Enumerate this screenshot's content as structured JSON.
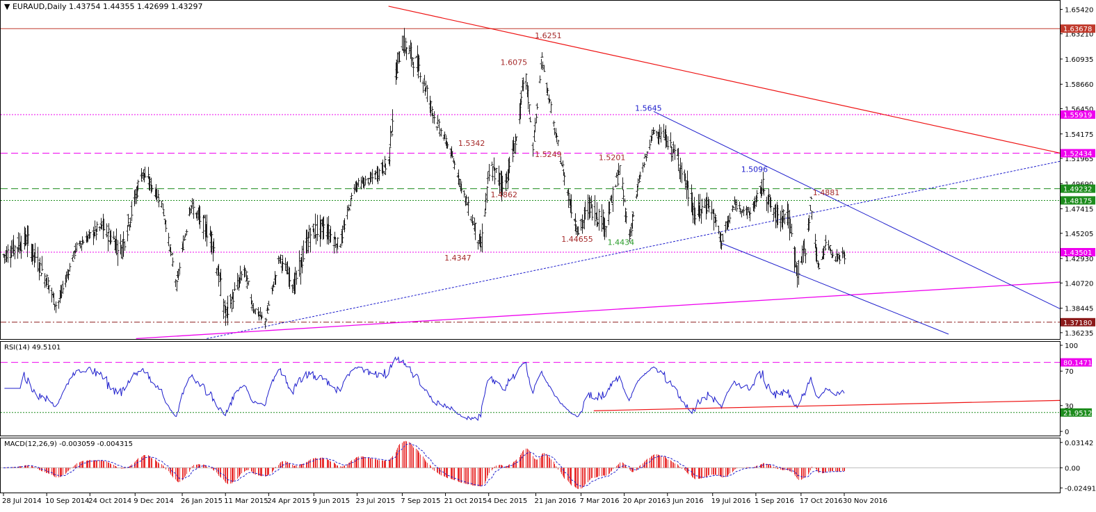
{
  "chart_data": [
    {
      "panel": "main",
      "type": "ohlc",
      "title": "EURAUD,Daily",
      "ohlc_header": "1.43754 1.44355 1.42699 1.43297",
      "y_ticks": [
        "1.65420",
        "1.63210",
        "1.60935",
        "1.58660",
        "1.56450",
        "1.54175",
        "1.51965",
        "1.49690",
        "1.47415",
        "1.45205",
        "1.42930",
        "1.40720",
        "1.38445",
        "1.36235"
      ],
      "ylim": [
        1.356,
        1.662
      ],
      "horizontal_levels": [
        {
          "label": "1.63678",
          "value": 1.63678,
          "color": "#c0392b",
          "style": "solid"
        },
        {
          "label": "1.55919",
          "value": 1.55919,
          "color": "#ee00ee",
          "style": "dotted"
        },
        {
          "label": "1.52434",
          "value": 1.52434,
          "color": "#ee00ee",
          "style": "dashed"
        },
        {
          "label": "1.49232",
          "value": 1.49232,
          "color": "#1d8c1d",
          "style": "dashed"
        },
        {
          "label": "1.48175",
          "value": 1.48175,
          "color": "#1d8c1d",
          "style": "dotted"
        },
        {
          "label": "1.43501",
          "value": 1.43501,
          "color": "#ee00ee",
          "style": "dotted"
        },
        {
          "label": "1.37180",
          "value": 1.3718,
          "color": "#8b1a1a",
          "style": "dashdot"
        }
      ],
      "annotations": [
        {
          "text": "1.6251",
          "color": "#a52a2a"
        },
        {
          "text": "1.6075",
          "color": "#a52a2a"
        },
        {
          "text": "1.5342",
          "color": "#a52a2a"
        },
        {
          "text": "1.5249",
          "color": "#a52a2a"
        },
        {
          "text": "1.5201",
          "color": "#a52a2a"
        },
        {
          "text": "1.4862",
          "color": "#a52a2a"
        },
        {
          "text": "1.44655",
          "color": "#a52a2a"
        },
        {
          "text": "1.4347",
          "color": "#a52a2a"
        },
        {
          "text": "1.4881",
          "color": "#a52a2a"
        },
        {
          "text": "1.5645",
          "color": "#1c1ccc"
        },
        {
          "text": "1.5096",
          "color": "#1c1ccc"
        },
        {
          "text": "1.4434",
          "color": "#2a9d2a"
        }
      ],
      "trendlines": [
        {
          "name": "resistance",
          "color": "#ee1111"
        },
        {
          "name": "rising-dotted-support",
          "color": "#1c1ccc"
        },
        {
          "name": "magenta-support",
          "color": "#ee00ee"
        },
        {
          "name": "channel-upper",
          "color": "#1c1ccc"
        },
        {
          "name": "channel-lower",
          "color": "#1c1ccc"
        }
      ],
      "anchors": [
        {
          "date": "2014-07-28",
          "close": 1.432
        },
        {
          "date": "2014-08-20",
          "close": 1.447
        },
        {
          "date": "2014-09-10",
          "close": 1.41
        },
        {
          "date": "2014-09-20",
          "close": 1.385
        },
        {
          "date": "2014-10-10",
          "close": 1.44
        },
        {
          "date": "2014-11-05",
          "close": 1.458
        },
        {
          "date": "2014-11-25",
          "close": 1.438
        },
        {
          "date": "2014-12-16",
          "close": 1.508
        },
        {
          "date": "2015-01-05",
          "close": 1.48
        },
        {
          "date": "2015-01-20",
          "close": 1.405
        },
        {
          "date": "2015-02-03",
          "close": 1.478
        },
        {
          "date": "2015-02-25",
          "close": 1.448
        },
        {
          "date": "2015-03-11",
          "close": 1.378
        },
        {
          "date": "2015-03-30",
          "close": 1.42
        },
        {
          "date": "2015-04-08",
          "close": 1.385
        },
        {
          "date": "2015-04-20",
          "close": 1.372
        },
        {
          "date": "2015-05-05",
          "close": 1.43
        },
        {
          "date": "2015-05-20",
          "close": 1.405
        },
        {
          "date": "2015-06-05",
          "close": 1.452
        },
        {
          "date": "2015-06-20",
          "close": 1.458
        },
        {
          "date": "2015-07-05",
          "close": 1.44
        },
        {
          "date": "2015-07-20",
          "close": 1.495
        },
        {
          "date": "2015-08-05",
          "close": 1.5
        },
        {
          "date": "2015-08-24",
          "close": 1.516
        },
        {
          "date": "2015-09-01",
          "close": 1.6
        },
        {
          "date": "2015-09-07",
          "close": 1.625
        },
        {
          "date": "2015-09-25",
          "close": 1.6
        },
        {
          "date": "2015-10-10",
          "close": 1.555
        },
        {
          "date": "2015-10-25",
          "close": 1.528
        },
        {
          "date": "2015-11-15",
          "close": 1.47
        },
        {
          "date": "2015-11-26",
          "close": 1.44
        },
        {
          "date": "2015-12-05",
          "close": 1.512
        },
        {
          "date": "2015-12-20",
          "close": 1.495
        },
        {
          "date": "2016-01-01",
          "close": 1.538
        },
        {
          "date": "2016-01-10",
          "close": 1.6
        },
        {
          "date": "2016-01-18",
          "close": 1.53
        },
        {
          "date": "2016-01-27",
          "close": 1.61
        },
        {
          "date": "2016-02-10",
          "close": 1.54
        },
        {
          "date": "2016-02-25",
          "close": 1.478
        },
        {
          "date": "2016-03-05",
          "close": 1.452
        },
        {
          "date": "2016-03-15",
          "close": 1.478
        },
        {
          "date": "2016-04-01",
          "close": 1.46
        },
        {
          "date": "2016-04-15",
          "close": 1.51
        },
        {
          "date": "2016-04-25",
          "close": 1.448
        },
        {
          "date": "2016-05-05",
          "close": 1.5
        },
        {
          "date": "2016-05-20",
          "close": 1.545
        },
        {
          "date": "2016-06-01",
          "close": 1.538
        },
        {
          "date": "2016-06-15",
          "close": 1.516
        },
        {
          "date": "2016-07-01",
          "close": 1.468
        },
        {
          "date": "2016-07-15",
          "close": 1.48
        },
        {
          "date": "2016-07-28",
          "close": 1.445
        },
        {
          "date": "2016-08-10",
          "close": 1.478
        },
        {
          "date": "2016-08-26",
          "close": 1.47
        },
        {
          "date": "2016-09-08",
          "close": 1.495
        },
        {
          "date": "2016-09-20",
          "close": 1.468
        },
        {
          "date": "2016-10-03",
          "close": 1.47
        },
        {
          "date": "2016-10-13",
          "close": 1.418
        },
        {
          "date": "2016-10-21",
          "close": 1.438
        },
        {
          "date": "2016-10-27",
          "close": 1.48
        },
        {
          "date": "2016-11-03",
          "close": 1.42
        },
        {
          "date": "2016-11-12",
          "close": 1.445
        },
        {
          "date": "2016-11-20",
          "close": 1.43
        },
        {
          "date": "2016-11-30",
          "close": 1.433
        }
      ]
    },
    {
      "panel": "rsi",
      "type": "line",
      "title": "RSI(14) 49.5101",
      "y_ticks": [
        "100",
        "70",
        "30",
        "0"
      ],
      "ylim": [
        0,
        100
      ],
      "levels": [
        {
          "label": "80.1471",
          "value": 80.1471,
          "color": "#ee00ee",
          "style": "dashed"
        },
        {
          "label": "21.9512",
          "value": 21.9512,
          "color": "#1d8c1d",
          "style": "dotted"
        }
      ],
      "series_color": "#1c1ccc"
    },
    {
      "panel": "macd",
      "type": "bar+line",
      "title": "MACD(12,26,9) -0.003059 -0.004315",
      "y_ticks": [
        "0.03142",
        "0.00",
        "-0.02491"
      ],
      "ylim": [
        -0.0315,
        0.0365
      ],
      "histogram_color": "#e83030",
      "signal_color": "#1c1ccc"
    }
  ],
  "x_axis": {
    "ticks": [
      "28 Jul 2014",
      "10 Sep 2014",
      "24 Oct 2014",
      "9 Dec 2014",
      "26 Jan 2015",
      "11 Mar 2015",
      "24 Apr 2015",
      "9 Jun 2015",
      "23 Jul 2015",
      "7 Sep 2015",
      "21 Oct 2015",
      "4 Dec 2015",
      "21 Jan 2016",
      "7 Mar 2016",
      "20 Apr 2016",
      "3 Jun 2016",
      "19 Jul 2016",
      "1 Sep 2016",
      "17 Oct 2016",
      "30 Nov 2016"
    ],
    "tick_dates": [
      "2014-07-28",
      "2014-09-10",
      "2014-10-24",
      "2014-12-09",
      "2015-01-26",
      "2015-03-11",
      "2015-04-24",
      "2015-06-09",
      "2015-07-23",
      "2015-09-07",
      "2015-10-21",
      "2015-12-04",
      "2016-01-21",
      "2016-03-07",
      "2016-04-20",
      "2016-06-03",
      "2016-07-19",
      "2016-09-01",
      "2016-10-17",
      "2016-11-30"
    ]
  },
  "colors": {
    "background": "#ffffff",
    "bars": "#202020",
    "grid_border": "#000000"
  }
}
